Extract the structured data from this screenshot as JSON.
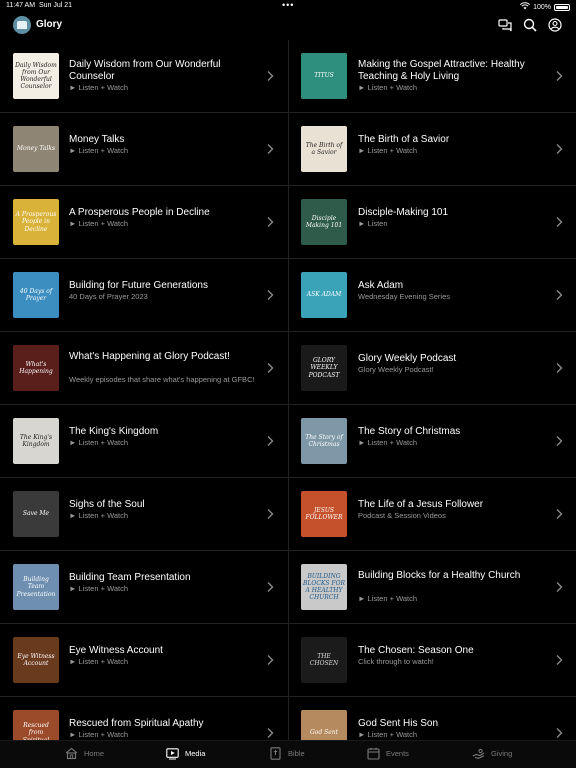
{
  "status_bar": {
    "time": "11:47 AM",
    "date": "Sun Jul 21",
    "dots": "•••",
    "battery": "100%"
  },
  "header": {
    "title": "Glory"
  },
  "rows": [
    {
      "left": {
        "title": "Daily Wisdom from Our Wonderful Counselor",
        "subtitle": "► Listen + Watch",
        "thumb_text": "Daily Wisdom from Our Wonderful Counselor",
        "thumb_bg": "#f4efe4",
        "thumb_fg": "#222222"
      },
      "right": {
        "title": "Making the Gospel Attractive: Healthy Teaching & Holy Living",
        "subtitle": "► Listen + Watch",
        "thumb_text": "TITUS",
        "thumb_bg": "#2f8f7f",
        "thumb_fg": "#ffffff"
      }
    },
    {
      "left": {
        "title": "Money Talks",
        "subtitle": "► Listen + Watch",
        "thumb_text": "Money Talks",
        "thumb_bg": "#8e8574",
        "thumb_fg": "#ffffff"
      },
      "right": {
        "title": "The Birth of a Savior",
        "subtitle": "► Listen + Watch",
        "thumb_text": "The Birth of a Savior",
        "thumb_bg": "#e9e2d4",
        "thumb_fg": "#222222"
      }
    },
    {
      "left": {
        "title": "A Prosperous People in Decline",
        "subtitle": "► Listen + Watch",
        "thumb_text": "A Prosperous People in Decline",
        "thumb_bg": "#d9b23a",
        "thumb_fg": "#ffffff"
      },
      "right": {
        "title": "Disciple-Making 101",
        "subtitle": "► Listen",
        "thumb_text": "Disciple Making 101",
        "thumb_bg": "#2f5b4a",
        "thumb_fg": "#ffffff"
      }
    },
    {
      "left": {
        "title": "Building for Future Generations",
        "subtitle": "40 Days of Prayer 2023",
        "thumb_text": "40 Days of Prayer",
        "thumb_bg": "#3c8dc0",
        "thumb_fg": "#ffffff"
      },
      "right": {
        "title": "Ask Adam",
        "subtitle": "Wednesday Evening Series",
        "thumb_text": "ASK ADAM",
        "thumb_bg": "#3aa3b8",
        "thumb_fg": "#ffffff"
      }
    },
    {
      "left": {
        "title": "What's Happening at Glory Podcast!",
        "subtitle": "Weekly episodes that share what's happening at GFBC!",
        "thumb_text": "What's Happening",
        "thumb_bg": "#5a1f1a",
        "thumb_fg": "#ffffff"
      },
      "right": {
        "title": "Glory Weekly Podcast",
        "subtitle": "Glory Weekly Podcast!",
        "thumb_text": "GLORY WEEKLY PODCAST",
        "thumb_bg": "#1a1a1a",
        "thumb_fg": "#ffffff"
      }
    },
    {
      "left": {
        "title": "The King's Kingdom",
        "subtitle": "► Listen + Watch",
        "thumb_text": "The King's Kingdom",
        "thumb_bg": "#d8d6d0",
        "thumb_fg": "#222222"
      },
      "right": {
        "title": "The Story of Christmas",
        "subtitle": "► Listen + Watch",
        "thumb_text": "The Story of Christmas",
        "thumb_bg": "#7f98a8",
        "thumb_fg": "#ffffff"
      }
    },
    {
      "left": {
        "title": "Sighs of the Soul",
        "subtitle": "► Listen + Watch",
        "thumb_text": "Save Me",
        "thumb_bg": "#3a3a3a",
        "thumb_fg": "#ffffff"
      },
      "right": {
        "title": "The Life of a Jesus Follower",
        "subtitle": "Podcast & Session Videos",
        "thumb_text": "JESUS FOLLOWER",
        "thumb_bg": "#c4512b",
        "thumb_fg": "#ffffff"
      }
    },
    {
      "left": {
        "title": "Building Team Presentation",
        "subtitle": "► Listen + Watch",
        "thumb_text": "Building Team Presentation",
        "thumb_bg": "#6e8fb0",
        "thumb_fg": "#ffffff"
      },
      "right": {
        "title": "Building Blocks for a Healthy Church",
        "subtitle": "► Listen + Watch",
        "thumb_text": "BUILDING BLOCKS FOR A HEALTHY CHURCH",
        "thumb_bg": "#c9c9c9",
        "thumb_fg": "#1e5a8c"
      }
    },
    {
      "left": {
        "title": "Eye Witness Account",
        "subtitle": "► Listen + Watch",
        "thumb_text": "Eye Witness Account",
        "thumb_bg": "#6a3a1e",
        "thumb_fg": "#ffffff"
      },
      "right": {
        "title": "The Chosen: Season One",
        "subtitle": "Click through to watch!",
        "thumb_text": "THE CHOSEN",
        "thumb_bg": "#1b1b1b",
        "thumb_fg": "#dddddd"
      }
    },
    {
      "left": {
        "title": "Rescued from Spiritual Apathy",
        "subtitle": "► Listen + Watch",
        "thumb_text": "Rescued from Spiritual",
        "thumb_bg": "#9b4a2a",
        "thumb_fg": "#ffffff"
      },
      "right": {
        "title": "God Sent His Son",
        "subtitle": "► Listen + Watch",
        "thumb_text": "God Sent",
        "thumb_bg": "#b58a5e",
        "thumb_fg": "#ffffff"
      }
    }
  ],
  "tabs": [
    {
      "label": "Home",
      "icon": "home-icon",
      "active": false
    },
    {
      "label": "Media",
      "icon": "media-icon",
      "active": true
    },
    {
      "label": "Bible",
      "icon": "bible-icon",
      "active": false
    },
    {
      "label": "Events",
      "icon": "calendar-icon",
      "active": false
    },
    {
      "label": "Giving",
      "icon": "giving-icon",
      "active": false
    }
  ],
  "colors": {
    "background": "#000000",
    "divider": "#222222",
    "subtitle": "#9a9a9a",
    "tab_inactive": "#7b7b7b"
  }
}
